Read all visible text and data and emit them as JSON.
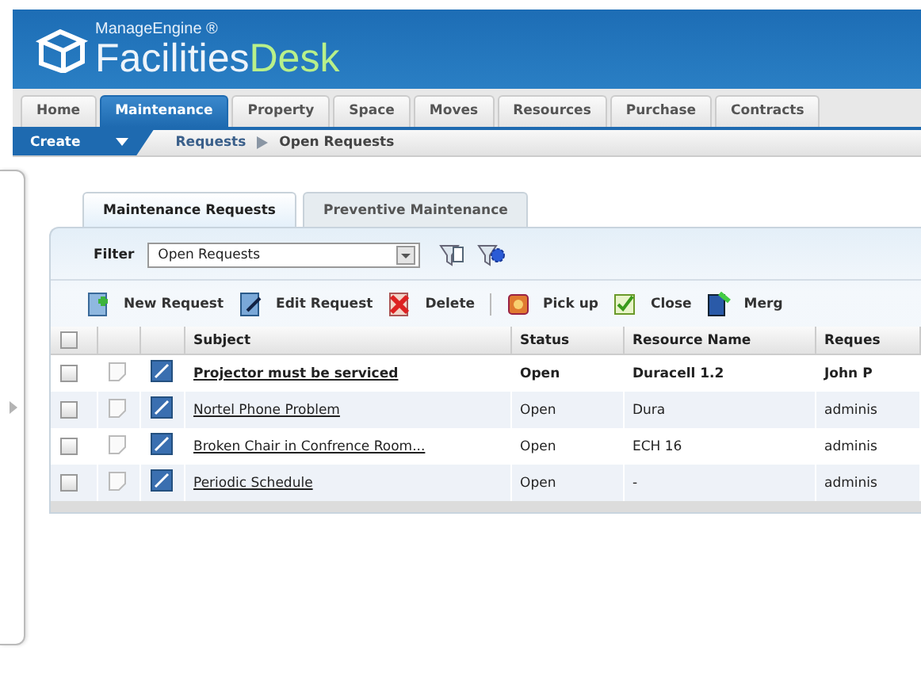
{
  "header": {
    "brand": "ManageEngine ®",
    "product": "Facilities",
    "product_accent": "Desk"
  },
  "tabs": [
    {
      "label": "Home",
      "selected": false
    },
    {
      "label": "Maintenance",
      "selected": true
    },
    {
      "label": "Property",
      "selected": false
    },
    {
      "label": "Space",
      "selected": false
    },
    {
      "label": "Moves",
      "selected": false
    },
    {
      "label": "Resources",
      "selected": false
    },
    {
      "label": "Purchase",
      "selected": false
    },
    {
      "label": "Contracts",
      "selected": false
    }
  ],
  "subbar": {
    "create": "Create",
    "breadcrumb": [
      "Requests",
      "Open Requests"
    ]
  },
  "subtabs": [
    {
      "label": "Maintenance Requests",
      "selected": true
    },
    {
      "label": "Preventive Maintenance",
      "selected": false
    }
  ],
  "filter": {
    "label": "Filter",
    "value": "Open Requests"
  },
  "toolbar": [
    {
      "label": "New Request",
      "kind": "new"
    },
    {
      "label": "Edit Request",
      "kind": "edit"
    },
    {
      "label": "Delete",
      "kind": "delete"
    },
    {
      "label": "Pick up",
      "kind": "pickup"
    },
    {
      "label": "Close",
      "kind": "close"
    },
    {
      "label": "Merg",
      "kind": "merge"
    }
  ],
  "table": {
    "all_checked": false,
    "columns": [
      "Subject",
      "Status",
      "Resource Name",
      "Reques"
    ],
    "rows": [
      {
        "checked": false,
        "unread": true,
        "cells": [
          "Projector must be serviced",
          "Open",
          "Duracell 1.2",
          "John P"
        ]
      },
      {
        "checked": false,
        "unread": false,
        "cells": [
          "Nortel Phone Problem",
          "Open",
          "Dura",
          "adminis"
        ]
      },
      {
        "checked": false,
        "unread": false,
        "cells": [
          "Broken Chair in Confrence Room...",
          "Open",
          "ECH 16",
          "adminis"
        ]
      },
      {
        "checked": false,
        "unread": false,
        "cells": [
          "Periodic Schedule",
          "Open",
          "-",
          "adminis"
        ]
      }
    ]
  }
}
